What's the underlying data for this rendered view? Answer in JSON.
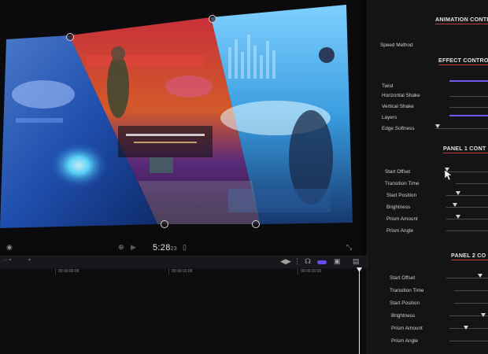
{
  "transport": {
    "timecode": "5:28",
    "timecode_sub": "23"
  },
  "timeline": {
    "ruler": [
      "00:00:00:00",
      "00:00:10:00",
      "00:00:20:00"
    ]
  },
  "inspector": {
    "animation_controls_title": "ANIMATION CONTR",
    "speed_method_label": "Speed Method",
    "effect_controls_title": "EFFECT CONTRO",
    "effect_params": [
      "Twist",
      "Horizontal Shake",
      "Vertical Shake",
      "Layers",
      "Edge Softness"
    ],
    "panel1_title": "PANEL 1 CONT",
    "panel1_params": [
      "Start Offset",
      "Transition Time",
      "Start Position",
      "Brightness",
      "Prism Amount",
      "Prism Angle"
    ],
    "panel2_title": "PANEL 2 CO",
    "panel2_params": [
      "Start Offset",
      "Transition Time",
      "Start Position",
      "Brightness",
      "Prism Amount",
      "Prism Angle"
    ]
  },
  "colors": {
    "accent": "#6d58f0",
    "underline": "#c43c3c"
  }
}
